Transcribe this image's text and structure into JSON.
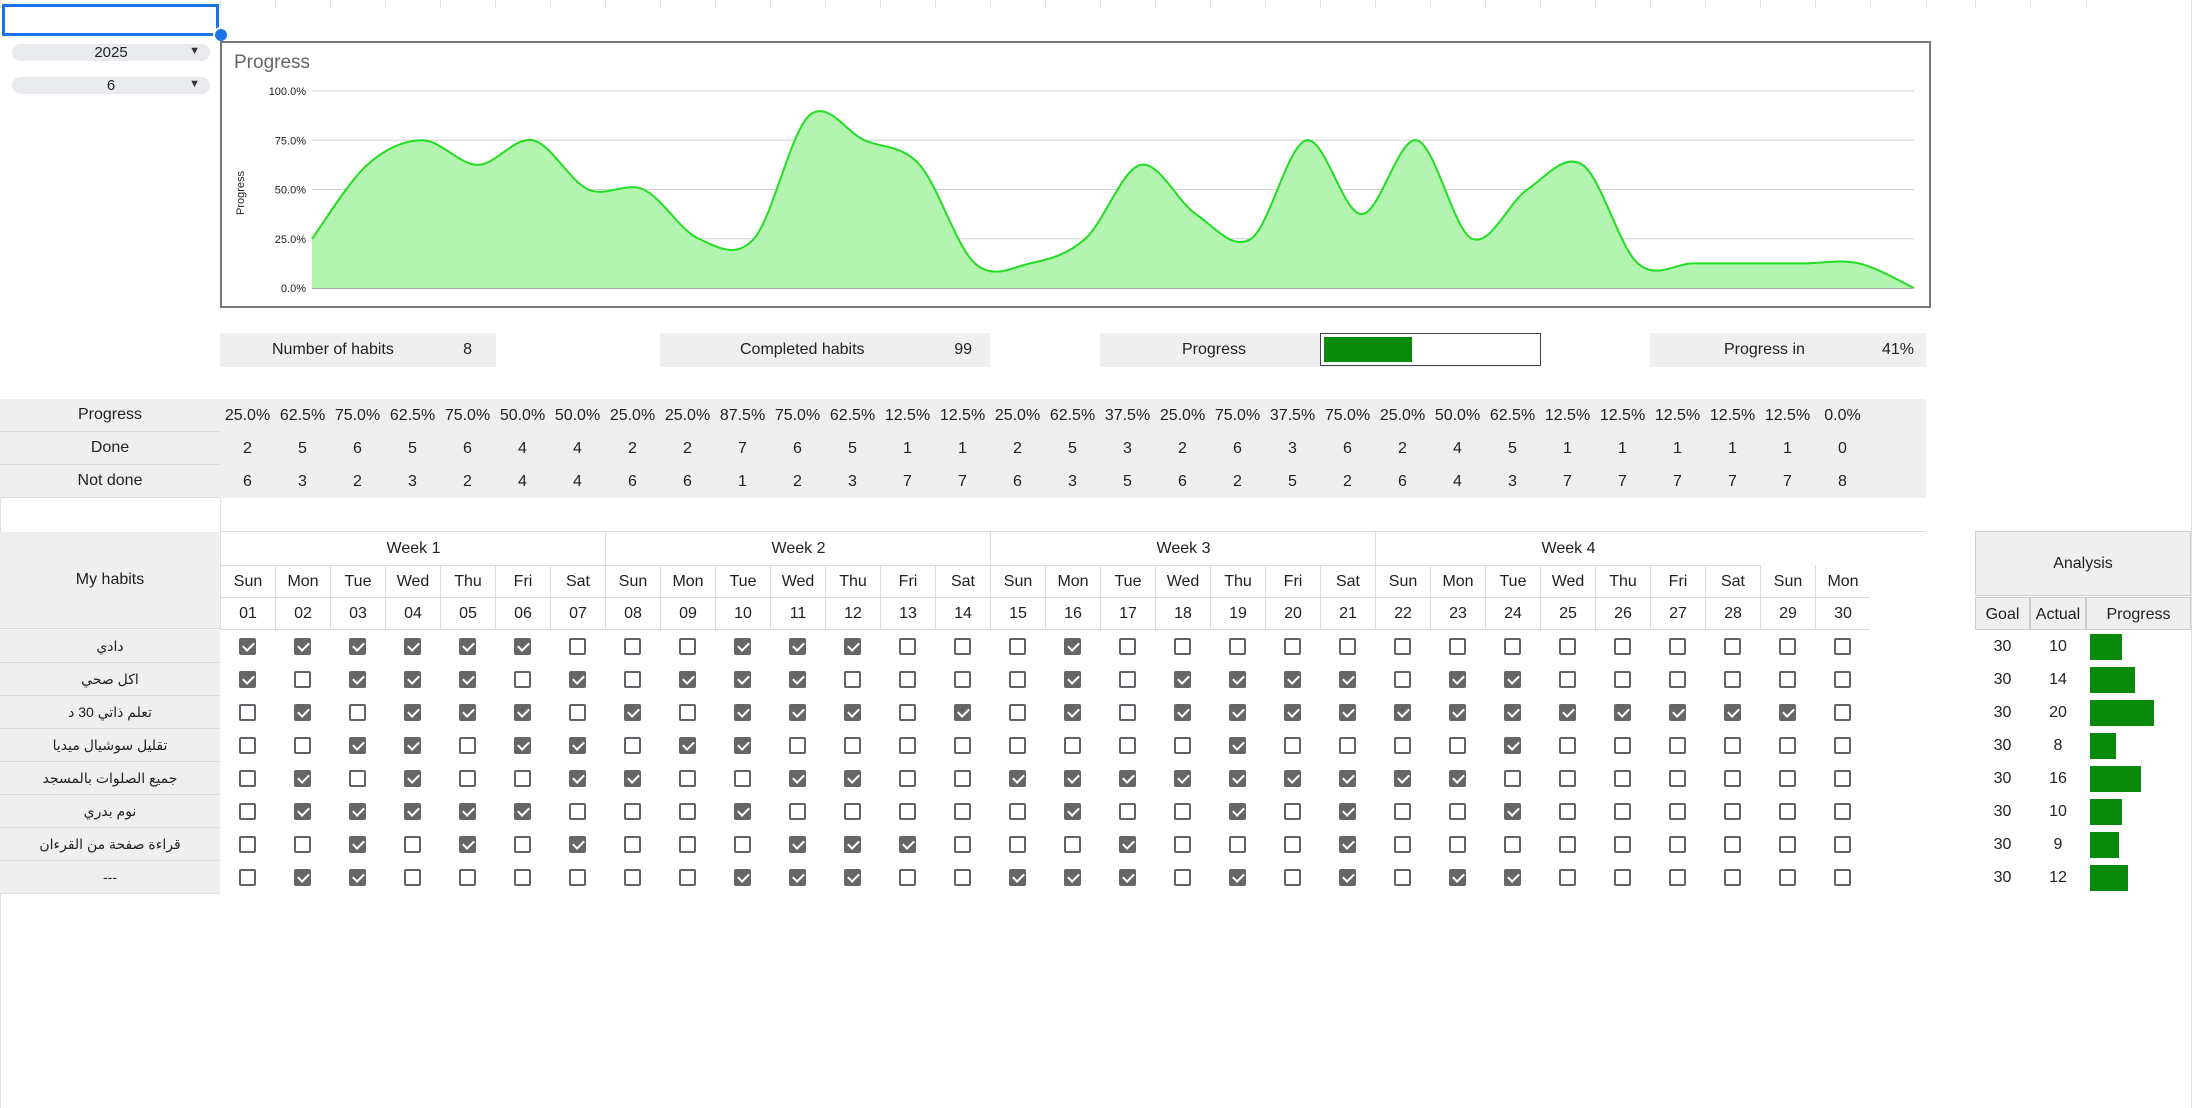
{
  "controls": {
    "year": "2025",
    "month": "6"
  },
  "chart_data": {
    "type": "area",
    "title": "Progress",
    "ylabel": "Progress",
    "yticks": [
      "100.0%",
      "75.0%",
      "50.0%",
      "25.0%",
      "0.0%"
    ],
    "ylim": [
      0,
      100
    ],
    "x": [
      1,
      2,
      3,
      4,
      5,
      6,
      7,
      8,
      9,
      10,
      11,
      12,
      13,
      14,
      15,
      16,
      17,
      18,
      19,
      20,
      21,
      22,
      23,
      24,
      25,
      26,
      27,
      28,
      29,
      30
    ],
    "values": [
      25.0,
      62.5,
      75.0,
      62.5,
      75.0,
      50.0,
      50.0,
      25.0,
      25.0,
      87.5,
      75.0,
      62.5,
      12.5,
      12.5,
      25.0,
      62.5,
      37.5,
      25.0,
      75.0,
      37.5,
      75.0,
      25.0,
      50.0,
      62.5,
      12.5,
      12.5,
      12.5,
      12.5,
      12.5,
      0.0
    ],
    "grid": true,
    "colors": {
      "fill": "#b3f5b0",
      "line": "#22dd22"
    }
  },
  "summary": {
    "habits_label": "Number of  habits",
    "habits_value": "8",
    "completed_label": "Completed habits",
    "completed_value": "99",
    "progress_label": "Progress",
    "progress_fraction": 0.41,
    "progress_in_label": "Progress in",
    "progress_in_value": "41%"
  },
  "stats": {
    "progress_label": "Progress",
    "done_label": "Done",
    "notdone_label": "Not done",
    "progress": [
      "25.0%",
      "62.5%",
      "75.0%",
      "62.5%",
      "75.0%",
      "50.0%",
      "50.0%",
      "25.0%",
      "25.0%",
      "87.5%",
      "75.0%",
      "62.5%",
      "12.5%",
      "12.5%",
      "25.0%",
      "62.5%",
      "37.5%",
      "25.0%",
      "75.0%",
      "37.5%",
      "75.0%",
      "25.0%",
      "50.0%",
      "62.5%",
      "12.5%",
      "12.5%",
      "12.5%",
      "12.5%",
      "12.5%",
      "0.0%"
    ],
    "done": [
      "2",
      "5",
      "6",
      "5",
      "6",
      "4",
      "4",
      "2",
      "2",
      "7",
      "6",
      "5",
      "1",
      "1",
      "2",
      "5",
      "3",
      "2",
      "6",
      "3",
      "6",
      "2",
      "4",
      "5",
      "1",
      "1",
      "1",
      "1",
      "1",
      "0"
    ],
    "notdone": [
      "6",
      "3",
      "2",
      "3",
      "2",
      "4",
      "4",
      "6",
      "6",
      "1",
      "2",
      "3",
      "7",
      "7",
      "6",
      "3",
      "5",
      "6",
      "2",
      "5",
      "2",
      "6",
      "4",
      "3",
      "7",
      "7",
      "7",
      "7",
      "7",
      "8"
    ]
  },
  "tracker": {
    "my_habits_label": "My habits",
    "weeks": [
      "Week 1",
      "Week 2",
      "Week 3",
      "Week 4"
    ],
    "days": [
      "Sun",
      "Mon",
      "Tue",
      "Wed",
      "Thu",
      "Fri",
      "Sat",
      "Sun",
      "Mon",
      "Tue",
      "Wed",
      "Thu",
      "Fri",
      "Sat",
      "Sun",
      "Mon",
      "Tue",
      "Wed",
      "Thu",
      "Fri",
      "Sat",
      "Sun",
      "Mon",
      "Tue",
      "Wed",
      "Thu",
      "Fri",
      "Sat",
      "Sun",
      "Mon"
    ],
    "dates": [
      "01",
      "02",
      "03",
      "04",
      "05",
      "06",
      "07",
      "08",
      "09",
      "10",
      "11",
      "12",
      "13",
      "14",
      "15",
      "16",
      "17",
      "18",
      "19",
      "20",
      "21",
      "22",
      "23",
      "24",
      "25",
      "26",
      "27",
      "28",
      "29",
      "30"
    ],
    "habits": [
      {
        "name": "دادي",
        "checks": [
          1,
          1,
          1,
          1,
          1,
          1,
          0,
          0,
          0,
          1,
          1,
          1,
          0,
          0,
          0,
          1,
          0,
          0,
          0,
          0,
          0,
          0,
          0,
          0,
          0,
          0,
          0,
          0,
          0,
          0
        ]
      },
      {
        "name": "اكل صحي",
        "checks": [
          1,
          0,
          1,
          1,
          1,
          0,
          1,
          0,
          1,
          1,
          1,
          0,
          0,
          0,
          0,
          1,
          0,
          1,
          1,
          1,
          1,
          0,
          1,
          1,
          0,
          0,
          0,
          0,
          0,
          0
        ]
      },
      {
        "name": "تعلم ذاتي 30 د",
        "checks": [
          0,
          1,
          0,
          1,
          1,
          1,
          0,
          1,
          0,
          1,
          1,
          1,
          0,
          1,
          0,
          1,
          0,
          1,
          1,
          1,
          1,
          1,
          1,
          1,
          1,
          1,
          1,
          1,
          1,
          0
        ]
      },
      {
        "name": "تقليل سوشيال ميديا",
        "checks": [
          0,
          0,
          1,
          1,
          0,
          1,
          1,
          0,
          1,
          1,
          0,
          0,
          0,
          0,
          0,
          0,
          0,
          0,
          1,
          0,
          0,
          0,
          0,
          1,
          0,
          0,
          0,
          0,
          0,
          0
        ]
      },
      {
        "name": "جميع الصلوات بالمسجد",
        "checks": [
          0,
          1,
          0,
          1,
          0,
          0,
          1,
          1,
          0,
          0,
          1,
          1,
          0,
          0,
          1,
          1,
          1,
          1,
          1,
          1,
          1,
          1,
          1,
          0,
          0,
          0,
          0,
          0,
          0,
          0
        ]
      },
      {
        "name": "نوم بدري",
        "checks": [
          0,
          1,
          1,
          1,
          1,
          1,
          0,
          0,
          0,
          1,
          0,
          0,
          0,
          0,
          0,
          1,
          0,
          0,
          1,
          0,
          1,
          0,
          0,
          1,
          0,
          0,
          0,
          0,
          0,
          0
        ]
      },
      {
        "name": "قراءة صفحة من القرءان",
        "checks": [
          0,
          0,
          1,
          0,
          1,
          0,
          1,
          0,
          0,
          0,
          1,
          1,
          1,
          0,
          0,
          0,
          1,
          0,
          0,
          0,
          1,
          0,
          0,
          0,
          0,
          0,
          0,
          0,
          0,
          0
        ]
      },
      {
        "name": "---",
        "checks": [
          0,
          1,
          1,
          0,
          0,
          0,
          0,
          0,
          0,
          1,
          1,
          1,
          0,
          0,
          1,
          1,
          1,
          0,
          1,
          0,
          1,
          0,
          1,
          1,
          0,
          0,
          0,
          0,
          0,
          0
        ]
      }
    ]
  },
  "analysis": {
    "title": "Analysis",
    "goal_label": "Goal",
    "actual_label": "Actual",
    "progress_label": "Progress",
    "rows": [
      {
        "goal": "30",
        "actual": "10",
        "fraction": 0.333
      },
      {
        "goal": "30",
        "actual": "14",
        "fraction": 0.467
      },
      {
        "goal": "30",
        "actual": "20",
        "fraction": 0.667
      },
      {
        "goal": "30",
        "actual": "8",
        "fraction": 0.267
      },
      {
        "goal": "30",
        "actual": "16",
        "fraction": 0.533
      },
      {
        "goal": "30",
        "actual": "10",
        "fraction": 0.333
      },
      {
        "goal": "30",
        "actual": "9",
        "fraction": 0.3
      },
      {
        "goal": "30",
        "actual": "12",
        "fraction": 0.4
      }
    ]
  }
}
